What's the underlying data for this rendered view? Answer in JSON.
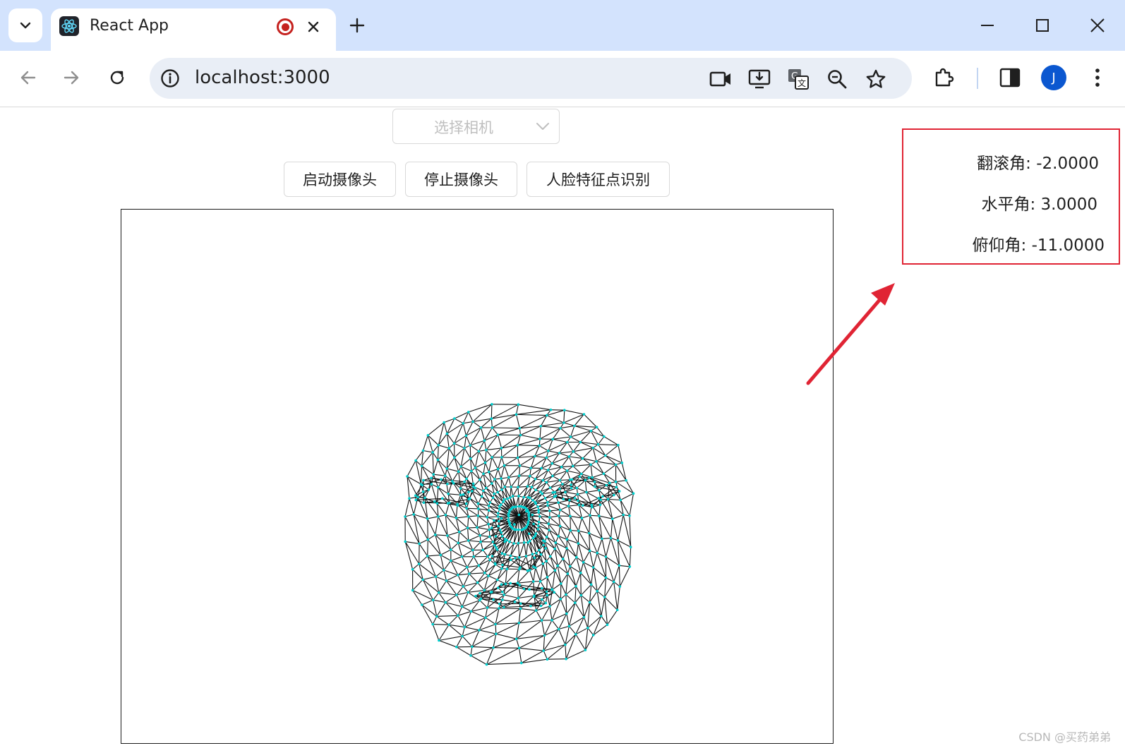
{
  "browser": {
    "tab": {
      "title": "React App"
    },
    "omnibox": {
      "url": "localhost:3000"
    },
    "profile": {
      "initial": "J"
    }
  },
  "page": {
    "camera_select": {
      "placeholder": "选择相机"
    },
    "buttons": {
      "start_camera": "启动摄像头",
      "stop_camera": "停止摄像头",
      "face_landmarks": "人脸特征点识别"
    },
    "head_pose": {
      "roll_label": "翻滚角:",
      "roll_value": "-2.0000",
      "yaw_label": "水平角:",
      "yaw_value": "3.0000",
      "pitch_label": "俯仰角:",
      "pitch_value": "-11.0000"
    },
    "watermark": "CSDN @买药弟弟"
  },
  "colors": {
    "tab_strip": "#d3e3fd",
    "omnibox": "#e9eef6",
    "accent_blue": "#0b57d0",
    "record_red": "#c5221f",
    "annotation_red": "#e02434",
    "mesh_line": "#111111",
    "mesh_point": "#00d0d0"
  },
  "icons": {
    "tab_search": "chevron-down-icon",
    "favicon": "react-logo-icon",
    "recording": "recording-icon",
    "tab_close": "close-icon",
    "new_tab": "plus-icon",
    "minimize": "minimize-icon",
    "maximize": "maximize-icon",
    "window_close": "close-icon",
    "back": "arrow-left-icon",
    "forward": "arrow-right-icon",
    "reload": "reload-icon",
    "site_info": "info-icon",
    "camera": "camera-icon",
    "install": "install-icon",
    "translate": "translate-icon",
    "zoom": "zoom-icon",
    "bookmark": "star-icon",
    "extensions": "puzzle-icon",
    "side_panel": "side-panel-icon",
    "menu": "kebab-menu-icon",
    "select_arrow": "chevron-down-icon"
  }
}
